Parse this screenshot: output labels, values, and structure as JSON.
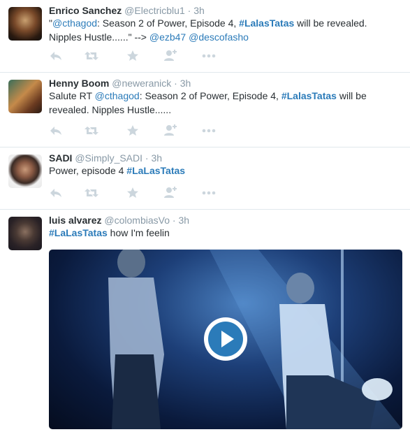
{
  "colors": {
    "link": "#2b7bb9",
    "muted": "#8899a6",
    "text": "#292f33",
    "icon": "#ccd6dd"
  },
  "tweets": [
    {
      "fullname": "Enrico Sanchez",
      "username": "@Electricblu1",
      "dot": "·",
      "time": "3h",
      "text": [
        {
          "t": "\"",
          "k": "plain"
        },
        {
          "t": "@cthagod",
          "k": "mention"
        },
        {
          "t": ": Season 2 of Power, Episode 4, ",
          "k": "plain"
        },
        {
          "t": "#LalasTatas",
          "k": "hashtag"
        },
        {
          "t": " will be revealed. Nipples Hustle......\" --> ",
          "k": "plain"
        },
        {
          "t": "@ezb47",
          "k": "mention"
        },
        {
          "t": " ",
          "k": "plain"
        },
        {
          "t": "@descofasho",
          "k": "mention"
        }
      ],
      "actions": [
        "reply-icon",
        "retweet-icon",
        "favorite-icon",
        "follow-icon",
        "more-icon"
      ]
    },
    {
      "fullname": "Henny Boom",
      "username": "@neweranick",
      "dot": "·",
      "time": "3h",
      "text": [
        {
          "t": "Salute RT ",
          "k": "plain"
        },
        {
          "t": "@cthagod",
          "k": "mention"
        },
        {
          "t": ": Season 2 of Power, Episode 4, ",
          "k": "plain"
        },
        {
          "t": "#LalasTatas",
          "k": "hashtag"
        },
        {
          "t": " will be revealed. Nipples Hustle......",
          "k": "plain"
        }
      ],
      "actions": [
        "reply-icon",
        "retweet-icon",
        "favorite-icon",
        "follow-icon",
        "more-icon"
      ]
    },
    {
      "fullname": "SADI",
      "username": "@Simply_SADI",
      "dot": "·",
      "time": "3h",
      "text": [
        {
          "t": "Power, episode 4 ",
          "k": "plain"
        },
        {
          "t": "#LaLasTatas",
          "k": "hashtag"
        }
      ],
      "actions": [
        "reply-icon",
        "retweet-icon",
        "favorite-icon",
        "follow-icon",
        "more-icon"
      ]
    },
    {
      "fullname": "luis alvarez",
      "username": "@colombiasVo",
      "dot": "·",
      "time": "3h",
      "text": [
        {
          "t": "#LaLasTatas",
          "k": "hashtag"
        },
        {
          "t": " how I'm feelin",
          "k": "plain"
        }
      ],
      "media": {
        "type": "video",
        "icon": "play-icon"
      }
    }
  ]
}
